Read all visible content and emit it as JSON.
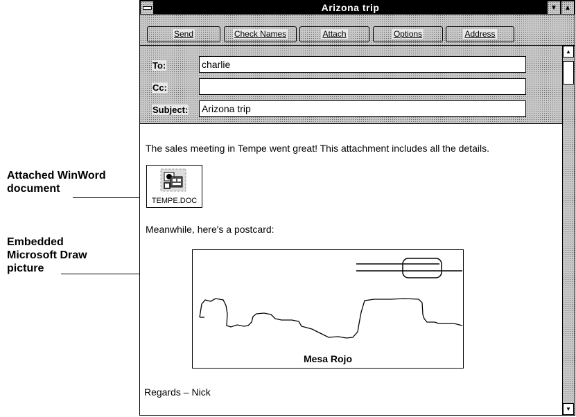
{
  "callouts": [
    {
      "lines": [
        "Attached WinWord",
        "document"
      ]
    },
    {
      "lines": [
        "Embedded",
        "Microsoft Draw",
        "picture"
      ]
    }
  ],
  "window": {
    "title": "Arizona trip",
    "toolbar": [
      "Send",
      "Check Names",
      "Attach",
      "Options",
      "Address"
    ],
    "fields": {
      "to_label": "To:",
      "to_value": "charlie",
      "cc_label": "Cc:",
      "cc_value": "",
      "subject_label": "Subject:",
      "subject_value": "Arizona trip"
    },
    "body": {
      "line1": "The sales meeting in Tempe went great!  This attachment includes all the details.",
      "attachment_name": "TEMPE.DOC",
      "line2": "Meanwhile, here's a postcard:",
      "picture_caption": "Mesa Rojo",
      "signature": "Regards – Nick"
    }
  },
  "icons": {
    "system_menu": "system-menu-icon",
    "minimize": "minimize-icon",
    "maximize": "maximize-icon",
    "attachment": "word-document-icon",
    "scroll_up": "arrow-up-icon",
    "scroll_down": "arrow-down-icon"
  }
}
